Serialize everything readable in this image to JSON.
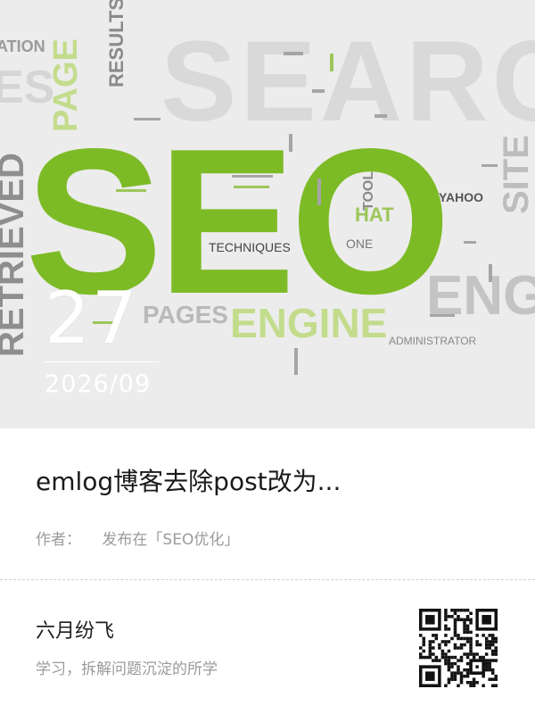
{
  "hero": {
    "image_words": {
      "seo": "SEO",
      "search": "SEARC",
      "engine": "ENGINE",
      "engine_right": "ENG",
      "pages": "PAGES",
      "page": "PAGE",
      "results": "RESULTS",
      "retrieved": "RETRIEVED",
      "site": "SITE",
      "hat": "HAT",
      "yahoo": "YAHOO",
      "techniques": "TECHNIQUES",
      "administrator": "ADMINISTRATOR",
      "tool": "TOOL",
      "one": "ONE",
      "ation": "ATION",
      "es": "ES"
    },
    "colors": {
      "green": "#7dbb26",
      "light_green": "#c3dc8c",
      "grey": "#c9c9c9",
      "dark_grey": "#8a8a8a"
    }
  },
  "date": {
    "day": "27",
    "year_month": "2026/09"
  },
  "article": {
    "title": "emlog博客去除post改为...",
    "author_label": "作者：",
    "category_text": "发布在「SEO优化」"
  },
  "site": {
    "name": "六月纷飞",
    "description": "学习，拆解问题沉淀的所学"
  },
  "icons": {
    "qr": "qr-code-icon"
  }
}
